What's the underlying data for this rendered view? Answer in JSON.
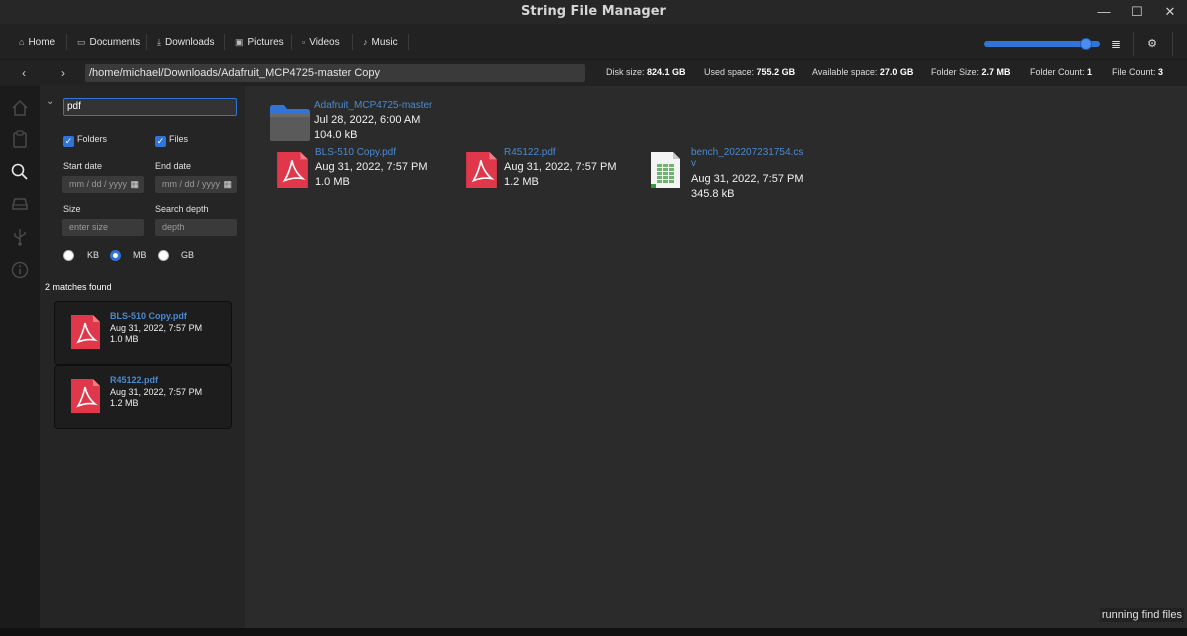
{
  "window": {
    "title": "String File Manager",
    "minimize_glyph": "—",
    "maximize_glyph": "☐",
    "close_glyph": "✕"
  },
  "bookmarks": [
    {
      "label": "Home",
      "icon": "home-icon",
      "glyph": "⌂"
    },
    {
      "label": "Documents",
      "icon": "folder-icon",
      "glyph": "▭"
    },
    {
      "label": "Downloads",
      "icon": "download-icon",
      "glyph": "⤓"
    },
    {
      "label": "Pictures",
      "icon": "picture-icon",
      "glyph": "▣"
    },
    {
      "label": "Videos",
      "icon": "video-icon",
      "glyph": "▫"
    },
    {
      "label": "Music",
      "icon": "music-icon",
      "glyph": "♪"
    }
  ],
  "toolbar": {
    "zoom_level": 0.92,
    "menu_glyph": "≣",
    "settings_glyph": "⚙"
  },
  "path": {
    "back_glyph": "‹",
    "forward_glyph": "›",
    "current": "/home/michael/Downloads/Adafruit_MCP4725-master Copy"
  },
  "stats": [
    {
      "label": "Disk size:",
      "value": "824.1 GB"
    },
    {
      "label": "Used space:",
      "value": "755.2 GB"
    },
    {
      "label": "Available space:",
      "value": "27.0 GB"
    },
    {
      "label": "Folder Size:",
      "value": "2.7 MB"
    },
    {
      "label": "Folder Count:",
      "value": "1"
    },
    {
      "label": "File Count:",
      "value": "3"
    }
  ],
  "search": {
    "collapse_glyph": "⌄",
    "query": "pdf",
    "folders_label": "Folders",
    "files_label": "Files",
    "check_glyph": "✓",
    "start_date_label": "Start date",
    "end_date_label": "End date",
    "date_placeholder": "mm / dd / yyyy",
    "calendar_glyph": "▦",
    "size_label": "Size",
    "size_placeholder": "enter size",
    "depth_label": "Search depth",
    "depth_placeholder": "depth",
    "units": [
      "KB",
      "MB",
      "GB"
    ],
    "selected_unit": "MB",
    "matches_text": "2 matches found",
    "results": [
      {
        "name": "BLS-510 Copy.pdf",
        "date": "Aug 31, 2022, 7:57 PM",
        "size": "1.0 MB"
      },
      {
        "name": "R45122.pdf",
        "date": "Aug 31, 2022, 7:57 PM",
        "size": "1.2 MB"
      }
    ]
  },
  "files": [
    {
      "name": "Adafruit_MCP4725-master",
      "date": "Jul 28, 2022, 6:00 AM",
      "size": "104.0 kB",
      "icon": "folder-icon"
    },
    {
      "name": "BLS-510 Copy.pdf",
      "date": "Aug 31, 2022, 7:57 PM",
      "size": "1.0 MB",
      "icon": "pdf-icon"
    },
    {
      "name": "R45122.pdf",
      "date": "Aug 31, 2022, 7:57 PM",
      "size": "1.2 MB",
      "icon": "pdf-icon"
    },
    {
      "name": "bench_202207231754.cs",
      "name_cont": "v",
      "date": "Aug 31, 2022, 7:57 PM",
      "size": "345.8 kB",
      "icon": "spreadsheet-icon"
    }
  ],
  "status": {
    "message": "running find files"
  },
  "colors": {
    "accent": "#2f74d6",
    "link": "#4a8ad0",
    "pdf": "#e0384a"
  }
}
